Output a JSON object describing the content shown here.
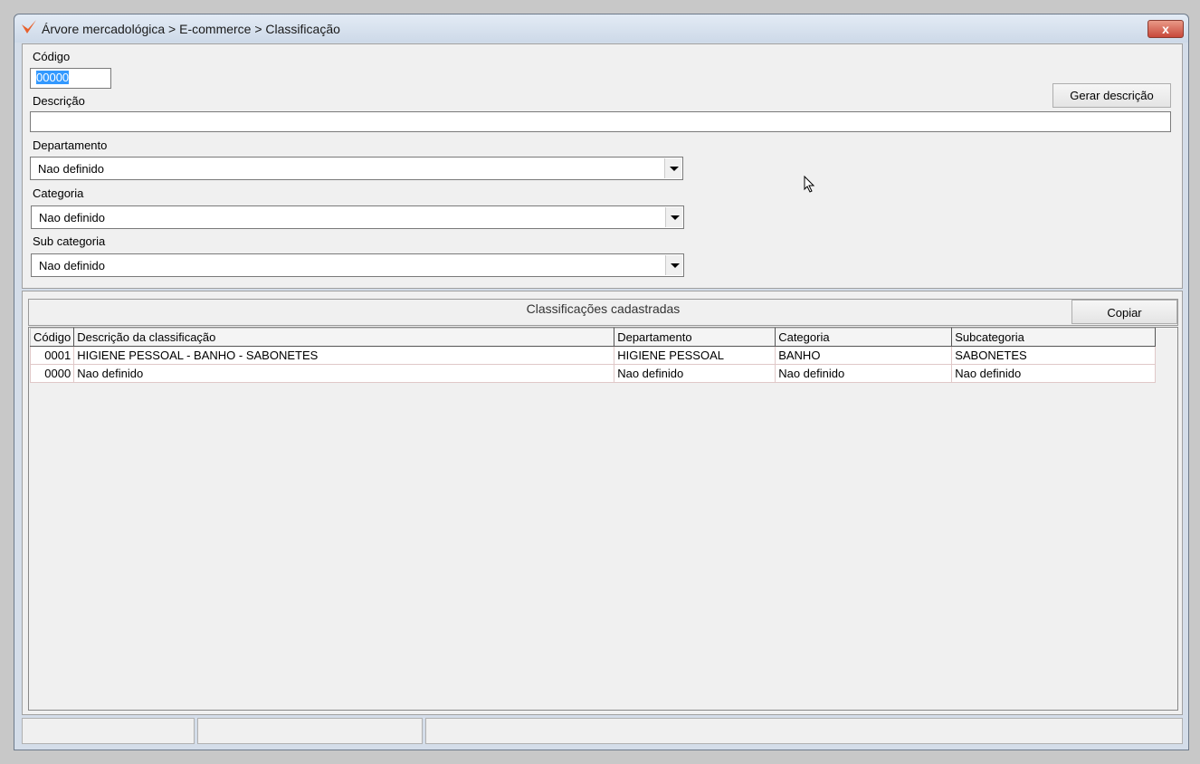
{
  "window": {
    "title": "Árvore mercadológica > E-commerce > Classificação",
    "close_label": "x"
  },
  "form": {
    "codigo_label": "Código",
    "codigo_value": "00000",
    "descricao_label": "Descrição",
    "descricao_value": "",
    "gerar_button": "Gerar descrição",
    "departamento_label": "Departamento",
    "departamento_value": "Nao definido",
    "categoria_label": "Categoria",
    "categoria_value": "Nao definido",
    "subcategoria_label": "Sub categoria",
    "subcategoria_value": "Nao definido"
  },
  "list": {
    "title": "Classificações cadastradas",
    "copy_button": "Copiar",
    "columns": [
      "Código",
      "Descrição da classificação",
      "Departamento",
      "Categoria",
      "Subcategoria"
    ],
    "rows": [
      [
        "0001",
        "HIGIENE PESSOAL - BANHO - SABONETES",
        "HIGIENE PESSOAL",
        "BANHO",
        "SABONETES"
      ],
      [
        "0000",
        "Nao definido",
        "Nao definido",
        "Nao definido",
        "Nao definido"
      ]
    ]
  }
}
